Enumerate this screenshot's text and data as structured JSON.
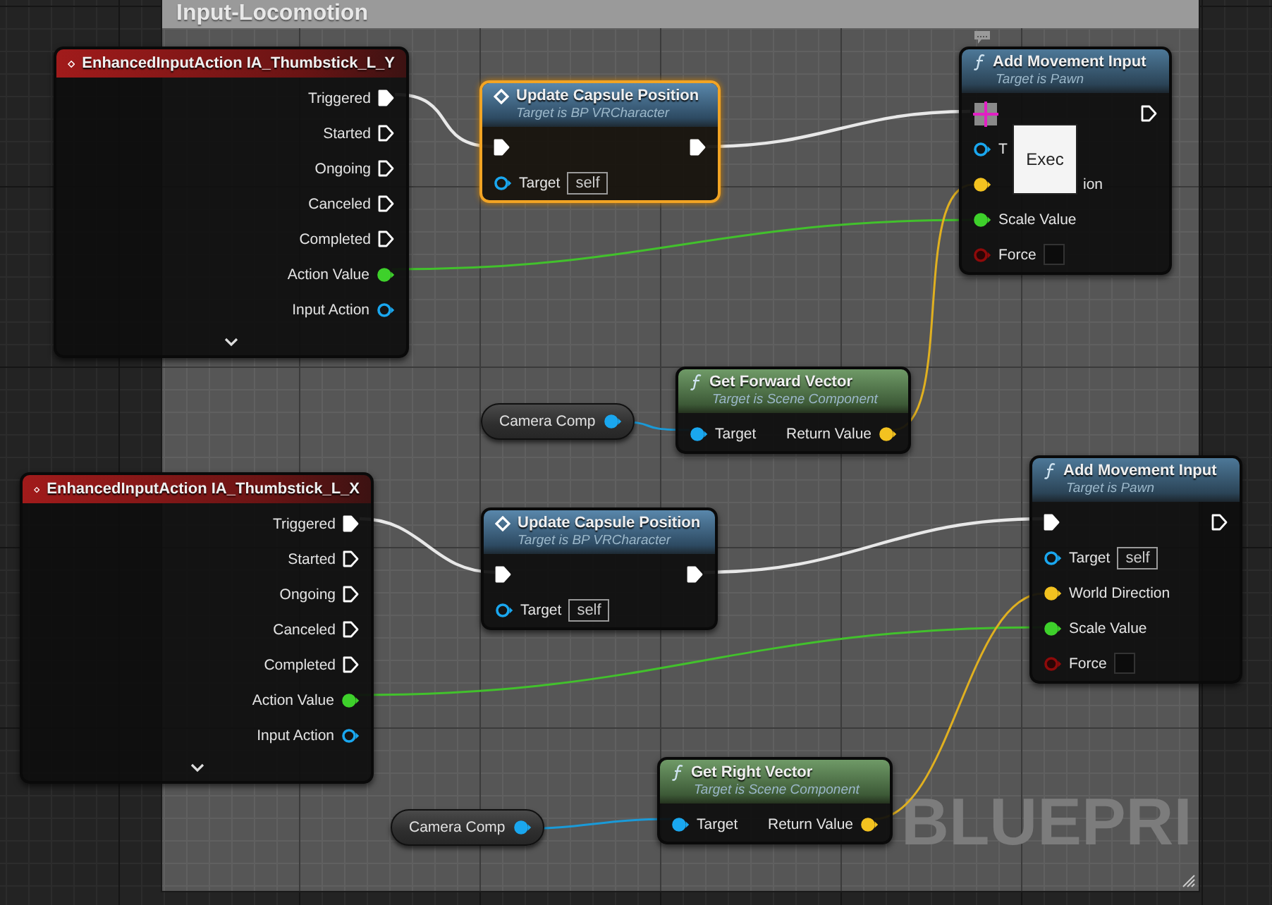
{
  "comment": {
    "title": "Input-Locomotion"
  },
  "nodes": [
    {
      "kind": "event",
      "title": "EnhancedInputAction IA_Thumbstick_L_Y",
      "selected": false,
      "collapsible": true,
      "rows": [
        {
          "right": {
            "kind": "exec",
            "label": "Triggered",
            "connected": true
          }
        },
        {
          "right": {
            "kind": "exec",
            "label": "Started",
            "connected": false
          }
        },
        {
          "right": {
            "kind": "exec",
            "label": "Ongoing",
            "connected": false
          }
        },
        {
          "right": {
            "kind": "exec",
            "label": "Canceled",
            "connected": false
          }
        },
        {
          "right": {
            "kind": "exec",
            "label": "Completed",
            "connected": false
          }
        },
        {
          "right": {
            "kind": "float",
            "label": "Action Value",
            "connected": true
          }
        },
        {
          "right": {
            "kind": "object",
            "label": "Input Action",
            "connected": false
          }
        }
      ]
    },
    {
      "kind": "call",
      "title": "Update Capsule Position",
      "subtitle": "Target is BP VRCharacter",
      "selected": true,
      "rows": [
        {
          "left": {
            "kind": "exec",
            "connected": true
          },
          "right": {
            "kind": "exec",
            "connected": true
          }
        },
        {
          "left": {
            "kind": "object",
            "label": "Target",
            "connected": false,
            "value": "self"
          }
        }
      ]
    },
    {
      "kind": "function",
      "title": "Add Movement Input",
      "subtitle": "Target is Pawn",
      "selected": false,
      "comment_bubble": true,
      "rows": [
        {
          "left": {
            "kind": "exec",
            "connected": true,
            "hovered": true
          },
          "right": {
            "kind": "exec",
            "connected": false
          }
        },
        {
          "left": {
            "kind": "object",
            "label": "T",
            "connected": false
          }
        },
        {
          "left": {
            "kind": "vector",
            "label": "ion",
            "connected": true,
            "label_covered": true
          }
        },
        {
          "left": {
            "kind": "float",
            "label": "Scale Value",
            "connected": true
          }
        },
        {
          "left": {
            "kind": "bool",
            "label": "Force",
            "connected": false,
            "checked": false
          }
        }
      ]
    },
    {
      "kind": "variable",
      "title": "Camera Comp",
      "selected": false,
      "rows": [
        {
          "right": {
            "kind": "object",
            "connected": true
          }
        }
      ]
    },
    {
      "kind": "pure",
      "title": "Get Forward Vector",
      "subtitle": "Target is Scene Component",
      "selected": false,
      "rows": [
        {
          "left": {
            "kind": "object",
            "label": "Target",
            "connected": true
          },
          "right": {
            "kind": "vector",
            "label": "Return Value",
            "connected": true
          }
        }
      ]
    },
    {
      "kind": "event",
      "title": "EnhancedInputAction IA_Thumbstick_L_X",
      "selected": false,
      "collapsible": true,
      "rows": [
        {
          "right": {
            "kind": "exec",
            "label": "Triggered",
            "connected": true
          }
        },
        {
          "right": {
            "kind": "exec",
            "label": "Started",
            "connected": false
          }
        },
        {
          "right": {
            "kind": "exec",
            "label": "Ongoing",
            "connected": false
          }
        },
        {
          "right": {
            "kind": "exec",
            "label": "Canceled",
            "connected": false
          }
        },
        {
          "right": {
            "kind": "exec",
            "label": "Completed",
            "connected": false
          }
        },
        {
          "right": {
            "kind": "float",
            "label": "Action Value",
            "connected": true
          }
        },
        {
          "right": {
            "kind": "object",
            "label": "Input Action",
            "connected": false
          }
        }
      ]
    },
    {
      "kind": "call",
      "title": "Update Capsule Position",
      "subtitle": "Target is BP VRCharacter",
      "selected": false,
      "rows": [
        {
          "left": {
            "kind": "exec",
            "connected": true
          },
          "right": {
            "kind": "exec",
            "connected": true
          }
        },
        {
          "left": {
            "kind": "object",
            "label": "Target",
            "connected": false,
            "value": "self"
          }
        }
      ]
    },
    {
      "kind": "function",
      "title": "Add Movement Input",
      "subtitle": "Target is Pawn",
      "selected": false,
      "rows": [
        {
          "left": {
            "kind": "exec",
            "connected": true
          },
          "right": {
            "kind": "exec",
            "connected": false
          }
        },
        {
          "left": {
            "kind": "object",
            "label": "Target",
            "connected": false,
            "value": "self"
          }
        },
        {
          "left": {
            "kind": "vector",
            "label": "World Direction",
            "connected": true
          }
        },
        {
          "left": {
            "kind": "float",
            "label": "Scale Value",
            "connected": true
          }
        },
        {
          "left": {
            "kind": "bool",
            "label": "Force",
            "connected": false,
            "checked": false
          }
        }
      ]
    },
    {
      "kind": "variable",
      "title": "Camera Comp",
      "selected": false,
      "rows": [
        {
          "right": {
            "kind": "object",
            "connected": true
          }
        }
      ]
    },
    {
      "kind": "pure",
      "title": "Get Right Vector",
      "subtitle": "Target is Scene Component",
      "selected": false,
      "rows": [
        {
          "left": {
            "kind": "object",
            "label": "Target",
            "connected": true
          },
          "right": {
            "kind": "vector",
            "label": "Return Value",
            "connected": true
          }
        }
      ]
    }
  ],
  "tooltip": {
    "text": "Exec"
  },
  "graph_corner_label": "BLUEPRI"
}
